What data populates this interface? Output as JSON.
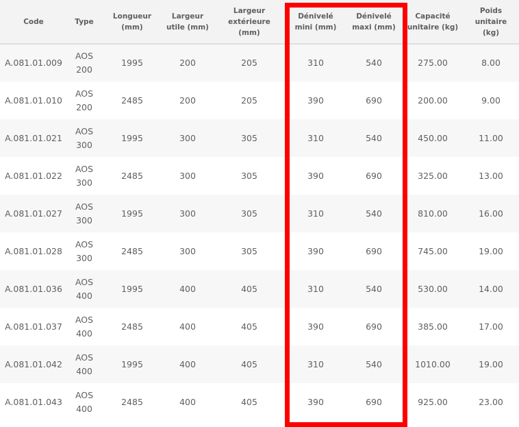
{
  "table": {
    "headers": [
      {
        "key": "code",
        "lines": [
          "Code"
        ]
      },
      {
        "key": "type",
        "lines": [
          "Type"
        ]
      },
      {
        "key": "longueur",
        "lines": [
          "Longueur",
          "(mm)"
        ]
      },
      {
        "key": "largeur_utile",
        "lines": [
          "Largeur",
          "utile (mm)"
        ]
      },
      {
        "key": "largeur_exterieure",
        "lines": [
          "Largeur",
          "extérieure",
          "(mm)"
        ]
      },
      {
        "key": "denivele_mini",
        "lines": [
          "Dénivelé",
          "mini (mm)"
        ]
      },
      {
        "key": "denivele_maxi",
        "lines": [
          "Dénivelé",
          "maxi (mm)"
        ]
      },
      {
        "key": "capacite",
        "lines": [
          "Capacité",
          "unitaire (kg)"
        ]
      },
      {
        "key": "poids",
        "lines": [
          "Poids",
          "unitaire",
          "(kg)"
        ]
      }
    ],
    "rows": [
      {
        "code": "A.081.01.009",
        "type": [
          "AOS",
          "200"
        ],
        "longueur": "1995",
        "largeur_utile": "200",
        "largeur_exterieure": "205",
        "denivele_mini": "310",
        "denivele_maxi": "540",
        "capacite": "275.00",
        "poids": "8.00"
      },
      {
        "code": "A.081.01.010",
        "type": [
          "AOS",
          "200"
        ],
        "longueur": "2485",
        "largeur_utile": "200",
        "largeur_exterieure": "205",
        "denivele_mini": "390",
        "denivele_maxi": "690",
        "capacite": "200.00",
        "poids": "9.00"
      },
      {
        "code": "A.081.01.021",
        "type": [
          "AOS",
          "300"
        ],
        "longueur": "1995",
        "largeur_utile": "300",
        "largeur_exterieure": "305",
        "denivele_mini": "310",
        "denivele_maxi": "540",
        "capacite": "450.00",
        "poids": "11.00"
      },
      {
        "code": "A.081.01.022",
        "type": [
          "AOS",
          "300"
        ],
        "longueur": "2485",
        "largeur_utile": "300",
        "largeur_exterieure": "305",
        "denivele_mini": "390",
        "denivele_maxi": "690",
        "capacite": "325.00",
        "poids": "13.00"
      },
      {
        "code": "A.081.01.027",
        "type": [
          "AOS",
          "300"
        ],
        "longueur": "1995",
        "largeur_utile": "300",
        "largeur_exterieure": "305",
        "denivele_mini": "310",
        "denivele_maxi": "540",
        "capacite": "810.00",
        "poids": "16.00"
      },
      {
        "code": "A.081.01.028",
        "type": [
          "AOS",
          "300"
        ],
        "longueur": "2485",
        "largeur_utile": "300",
        "largeur_exterieure": "305",
        "denivele_mini": "390",
        "denivele_maxi": "690",
        "capacite": "745.00",
        "poids": "19.00"
      },
      {
        "code": "A.081.01.036",
        "type": [
          "AOS",
          "400"
        ],
        "longueur": "1995",
        "largeur_utile": "400",
        "largeur_exterieure": "405",
        "denivele_mini": "310",
        "denivele_maxi": "540",
        "capacite": "530.00",
        "poids": "14.00"
      },
      {
        "code": "A.081.01.037",
        "type": [
          "AOS",
          "400"
        ],
        "longueur": "2485",
        "largeur_utile": "400",
        "largeur_exterieure": "405",
        "denivele_mini": "390",
        "denivele_maxi": "690",
        "capacite": "385.00",
        "poids": "17.00"
      },
      {
        "code": "A.081.01.042",
        "type": [
          "AOS",
          "400"
        ],
        "longueur": "1995",
        "largeur_utile": "400",
        "largeur_exterieure": "405",
        "denivele_mini": "310",
        "denivele_maxi": "540",
        "capacite": "1010.00",
        "poids": "19.00"
      },
      {
        "code": "A.081.01.043",
        "type": [
          "AOS",
          "400"
        ],
        "longueur": "2485",
        "largeur_utile": "400",
        "largeur_exterieure": "405",
        "denivele_mini": "390",
        "denivele_maxi": "690",
        "capacite": "925.00",
        "poids": "23.00"
      }
    ]
  },
  "colors": {
    "highlight": "#ff0000",
    "header_bg": "#f3f3f3",
    "row_alt_bg": "#f7f7f7",
    "text": "#5f5f5f"
  }
}
